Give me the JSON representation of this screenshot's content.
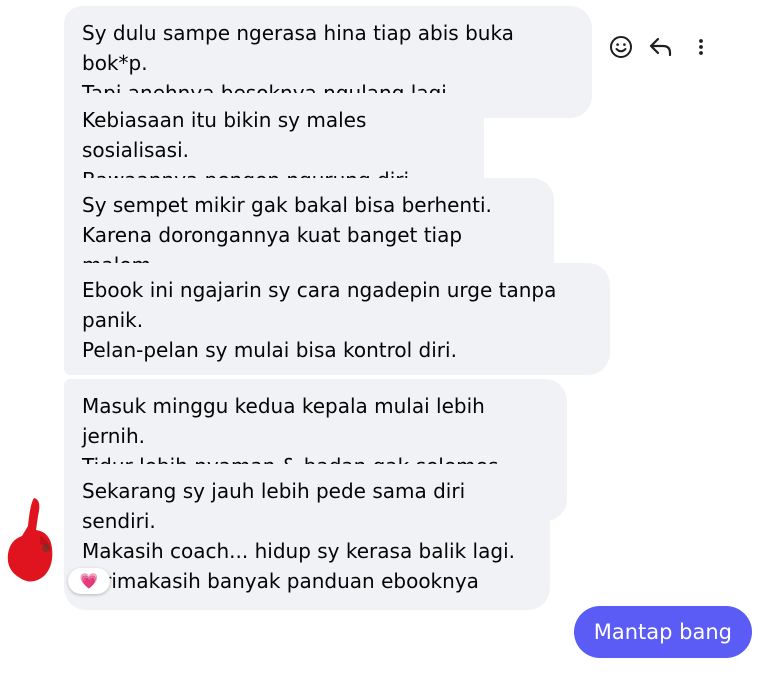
{
  "messages": [
    {
      "text": "Sy dulu sampe ngerasa hina tiap abis buka bok*p.\nTapi anehnya besoknya ngulang lagi."
    },
    {
      "text": "Kebiasaan itu bikin sy males sosialisasi.\nBawaannya pengen ngurung diri terus."
    },
    {
      "text": "Sy sempet mikir gak bakal bisa berhenti.\nKarena dorongannya kuat banget tiap malem."
    },
    {
      "text": "Ebook ini ngajarin sy cara ngadepin urge tanpa\npanik.\nPelan-pelan sy mulai bisa kontrol diri."
    },
    {
      "text": "Masuk minggu kedua kepala mulai lebih jernih.\nTidur lebih nyaman & badan gak selemes dulu."
    },
    {
      "text": "Sekarang sy jauh lebih pede sama diri sendiri.\nMakasih coach... hidup sy kerasa balik lagi.\nTerimakasih banyak panduan ebooknya"
    }
  ],
  "hover_actions": {
    "icons": [
      "smiley-react-icon",
      "reply-arrow-icon",
      "more-vertical-icon"
    ]
  },
  "reaction": {
    "emoji": "💗",
    "icon": "heart-reaction-icon"
  },
  "sent_message": {
    "text": "Mantap bang"
  },
  "colors": {
    "received_bubble": "#f0f2f5",
    "sent_bubble": "#5b5bf5",
    "sent_text": "#ffffff",
    "avatar_red": "#e0141e"
  }
}
